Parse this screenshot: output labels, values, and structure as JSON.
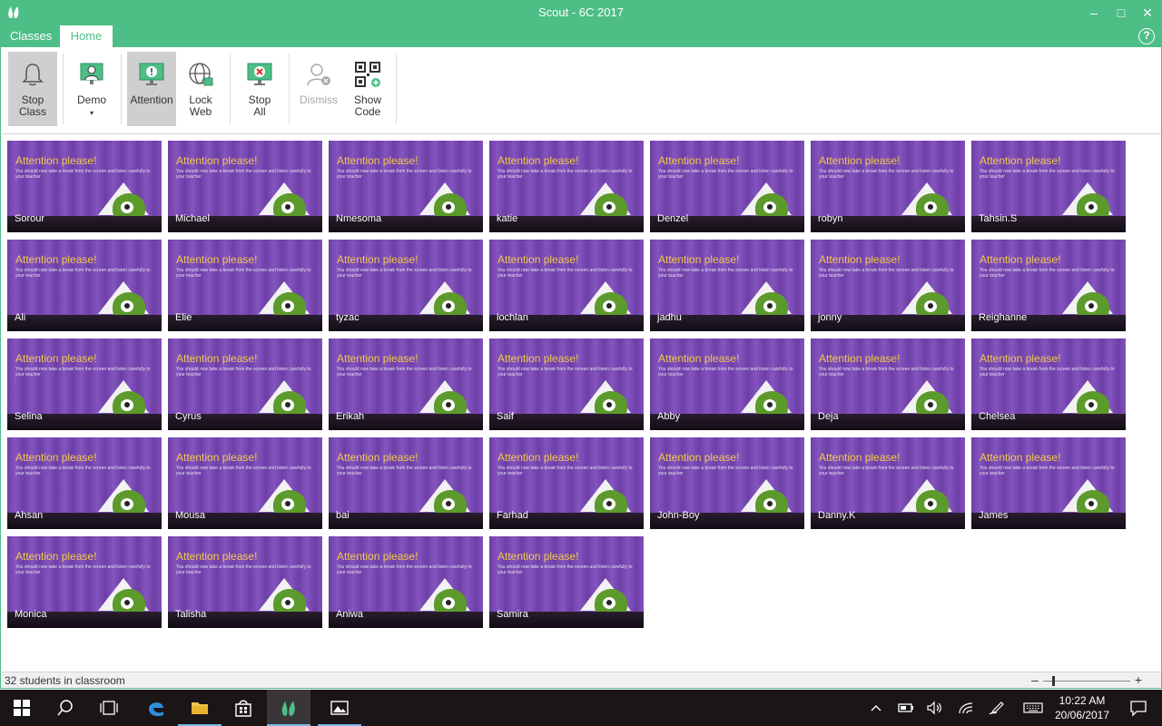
{
  "window": {
    "title": "Scout - 6C 2017"
  },
  "tabs": [
    {
      "label": "Classes",
      "active": false
    },
    {
      "label": "Home",
      "active": true
    }
  ],
  "ribbon": {
    "stop_class": "Stop Class",
    "demo": "Demo",
    "attention": "Attention",
    "lock_web": "Lock Web",
    "stop_all": "Stop All",
    "dismiss": "Dismiss",
    "show_code": "Show Code"
  },
  "screen": {
    "heading": "Attention please!",
    "message": "You should now take a break from the screen and listen carefully to your teacher"
  },
  "students": [
    "Sorour",
    "Michael",
    "Nmesoma",
    "katie",
    "Denzel",
    "robyn",
    "Tahsin.S",
    "Ali",
    "Elie",
    "tyzac",
    "lochlan",
    "jadhu",
    "jonny",
    "Reighanne",
    "Selina",
    "Cyrus",
    "Erikah",
    "Saif",
    "Abby",
    "Deja",
    "Chelsea",
    "Ahsan",
    "Mousa",
    "bai",
    "Farhad",
    "John-Boy",
    "Danny.K",
    "James",
    "Monica",
    "Talisha",
    "Aniwa",
    "Samira"
  ],
  "selected_student": "Farhad",
  "status": {
    "count_text": "32 students in classroom",
    "zoom_level": 0.1
  },
  "taskbar": {
    "time": "10:22 AM",
    "date": "20/06/2017"
  },
  "colors": {
    "accent": "#4dbe86",
    "tile": "#7b4fb3",
    "heading": "#f2c94c"
  }
}
